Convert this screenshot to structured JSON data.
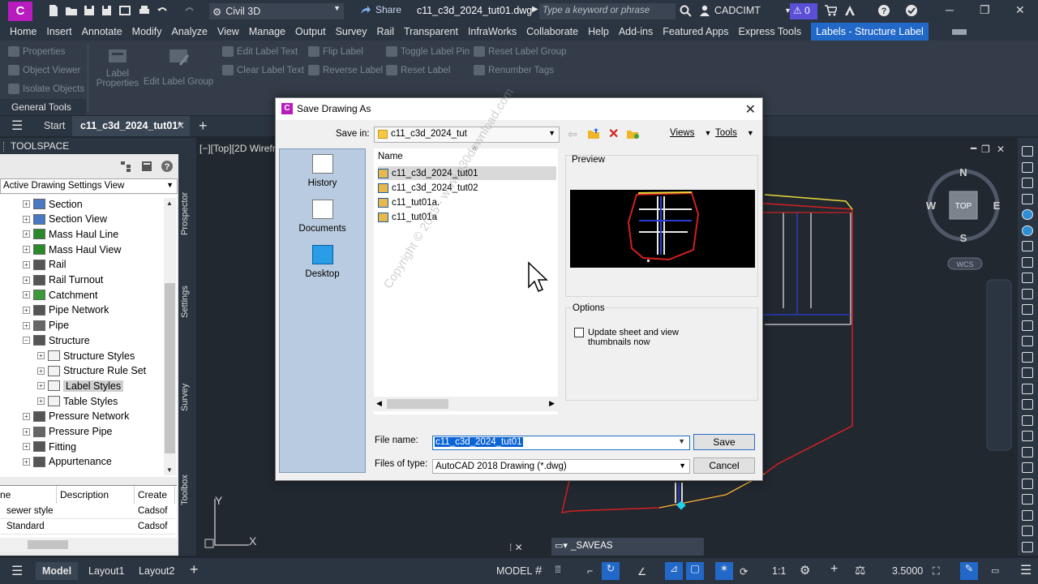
{
  "app": {
    "badge": "C",
    "workspace": "Civil 3D",
    "share": "Share",
    "document_title": "c11_c3d_2024_tut01.dwg",
    "search_placeholder": "Type a keyword or phrase",
    "user": "CADCIMT",
    "alerts": "0"
  },
  "menu": [
    "Home",
    "Insert",
    "Annotate",
    "Modify",
    "Analyze",
    "View",
    "Manage",
    "Output",
    "Survey",
    "Rail",
    "Transparent",
    "InfraWorks",
    "Collaborate",
    "Help",
    "Add-ins",
    "Featured Apps",
    "Express Tools",
    "Labels - Structure Label"
  ],
  "menu_active_index": 17,
  "ribbon": {
    "properties": "Properties",
    "object_viewer": "Object Viewer",
    "isolate_objects": "Isolate Objects",
    "label_properties_line1": "Label",
    "label_properties_line2": "Properties",
    "edit_label_group": "Edit Label Group",
    "edit_label_text": "Edit Label Text",
    "clear_label_text": "Clear Label Text",
    "flip_label": "Flip Label",
    "reverse_label": "Reverse Label",
    "toggle_label_pin": "Toggle Label Pin",
    "reset_label": "Reset Label",
    "reset_label_group": "Reset Label Group",
    "renumber_tags": "Renumber Tags",
    "general_tools": "General Tools"
  },
  "file_tabs": {
    "start": "Start",
    "current": "c11_c3d_2024_tut01*"
  },
  "toolspace": {
    "title": "TOOLSPACE",
    "view_select": "Active Drawing Settings View",
    "tree": [
      "Section",
      "Section View",
      "Mass Haul Line",
      "Mass Haul View",
      "Rail",
      "Rail Turnout",
      "Catchment",
      "Pipe Network",
      "Pipe",
      "Structure",
      "Structure Styles",
      "Structure Rule Set",
      "Label Styles",
      "Table Styles",
      "Pressure Network",
      "Pressure Pipe",
      "Fitting",
      "Appurtenance"
    ],
    "list_headers": [
      "ne",
      "Description",
      "Create"
    ],
    "list_rows": [
      [
        "sewer style",
        "",
        "Cadsof"
      ],
      [
        "Standard",
        "",
        "Cadsof"
      ]
    ],
    "side_tabs": [
      "Prospector",
      "Settings",
      "Survey",
      "Toolbox"
    ]
  },
  "viewport": {
    "label": "[−][Top][2D Wirefra",
    "compass": {
      "n": "N",
      "s": "S",
      "e": "E",
      "w": "W",
      "top": "TOP"
    },
    "wcs": "WCS",
    "ucs_y": "Y",
    "ucs_x": "X"
  },
  "command_line": "_SAVEAS",
  "status": {
    "model_space": "MODEL",
    "scale": "1:1",
    "value": "3.5000",
    "tabs": [
      "Model",
      "Layout1",
      "Layout2"
    ]
  },
  "dialog": {
    "title": "Save Drawing As",
    "save_in_label": "Save in:",
    "save_in_value": "c11_c3d_2024_tut",
    "views": "Views",
    "tools": "Tools",
    "places": [
      "History",
      "Documents",
      "Desktop"
    ],
    "name_header": "Name",
    "files": [
      "c11_c3d_2024_tut01",
      "c11_c3d_2024_tut02",
      "c11_tut01a.",
      "c11_tut01a"
    ],
    "selected_file_index": 0,
    "preview_label": "Preview",
    "options_label": "Options",
    "update_thumbnails_line1": "Update sheet and view",
    "update_thumbnails_line2": "thumbnails now",
    "file_name_label": "File name:",
    "file_name_value": "c11_c3d_2024_tut01",
    "file_type_label": "Files of type:",
    "file_type_value": "AutoCAD 2018 Drawing (*.dwg)",
    "save_button": "Save",
    "cancel_button": "Cancel"
  },
  "colors": {
    "accent": "#2168c9",
    "app_badge": "#b81cbe",
    "alert": "#5a4fd6",
    "boundary_red": "#d42020",
    "boundary_yellow": "#e8d83a",
    "pipe_blue": "#2a3ed8"
  },
  "watermark": "Copyright © 2025 - www.p30download.com"
}
